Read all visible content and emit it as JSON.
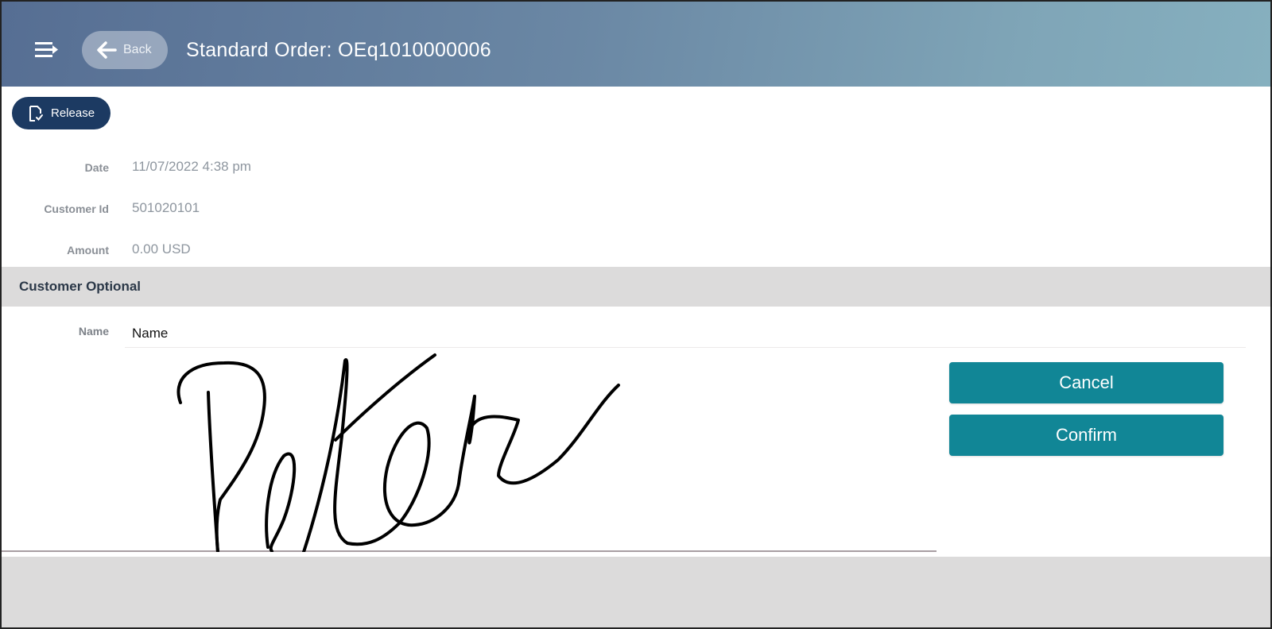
{
  "header": {
    "menu_icon": "menu-arrow-icon",
    "back_label": "Back",
    "back_icon": "arrow-left-icon",
    "title": "Standard Order: OEq1010000006"
  },
  "toolbar": {
    "release_label": "Release",
    "release_icon": "document-check-icon"
  },
  "fields": [
    {
      "label": "Date",
      "value": "11/07/2022 4:38 pm"
    },
    {
      "label": "Customer Id",
      "value": "501020101"
    },
    {
      "label": "Amount",
      "value": "0.00 USD"
    }
  ],
  "section": {
    "title": "Customer Optional",
    "name_label": "Name",
    "name_value": "Name"
  },
  "signature": {
    "text": "Peter"
  },
  "actions": {
    "cancel_label": "Cancel",
    "confirm_label": "Confirm"
  },
  "colors": {
    "primary_dark": "#1c3a62",
    "action_teal": "#118696",
    "section_gray": "#dcdbdb"
  }
}
